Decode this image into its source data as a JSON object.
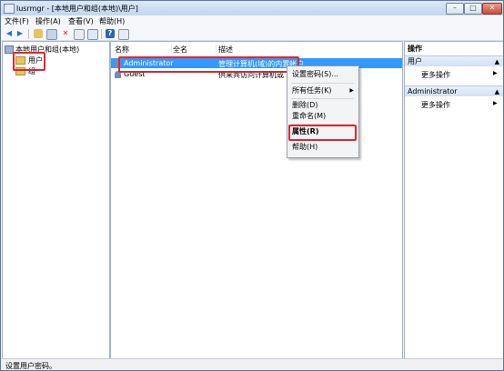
{
  "window": {
    "title": "lusrmgr - [本地用户和组(本地)\\用户]",
    "controls": {
      "min": "–",
      "max": "□",
      "close": "✕"
    }
  },
  "menubar": {
    "items": [
      "文件(F)",
      "操作(A)",
      "查看(V)",
      "帮助(H)"
    ]
  },
  "toolbar": {
    "icons": [
      "back-icon",
      "forward-icon",
      "up-folder-icon",
      "show-hide-tree-icon",
      "delete-icon",
      "properties-icon",
      "export-icon",
      "help-icon",
      "view-icon"
    ]
  },
  "tree": {
    "root": "本地用户和组(本地)",
    "children": [
      "用户",
      "组"
    ]
  },
  "list": {
    "columns": [
      "名称",
      "全名",
      "描述"
    ],
    "rows": [
      {
        "name": "Administrator",
        "fullname": "",
        "description": "管理计算机(域)的内置帐户",
        "selected": true
      },
      {
        "name": "Guest",
        "fullname": "",
        "description": "供来宾访问计算机或",
        "selected": false
      }
    ]
  },
  "context_menu": {
    "items": [
      {
        "label": "设置密码(S)...",
        "submenu": false
      },
      {
        "label": "所有任务(K)",
        "submenu": true
      },
      {
        "label": "删除(D)",
        "submenu": false
      },
      {
        "label": "重命名(M)",
        "submenu": false
      },
      {
        "label": "属性(R)",
        "submenu": false,
        "bold": true
      },
      {
        "label": "帮助(H)",
        "submenu": false
      }
    ],
    "submenu_arrow": "▶"
  },
  "actions": {
    "header": "操作",
    "sections": [
      {
        "title": "用户",
        "link": "更多操作"
      },
      {
        "title": "Administrator",
        "link": "更多操作"
      }
    ],
    "section_arrow": "▲",
    "link_arrow": "▶"
  },
  "status": {
    "text": "设置用户密码。"
  },
  "colors": {
    "highlight": "#e0262f",
    "selection": "#3399ff"
  }
}
